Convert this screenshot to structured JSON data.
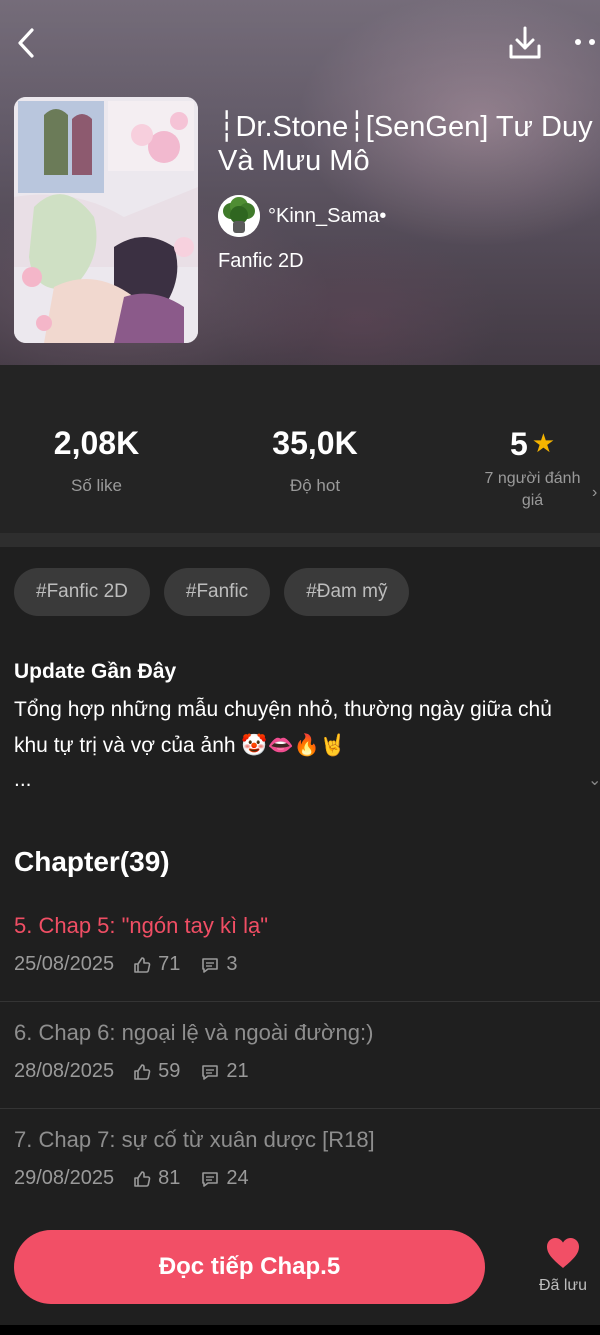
{
  "story": {
    "title": "┆Dr.Stone┆[SenGen] Tư Duy\nVà Mưu Mô",
    "author": "°Kinn_Sama•",
    "genre": "Fanfic 2D"
  },
  "stats": [
    {
      "value": "2,08K",
      "label": "Số like"
    },
    {
      "value": "35,0K",
      "label": "Độ hot"
    },
    {
      "value": "5",
      "label": "7 người đánh\ngiá"
    }
  ],
  "tags": [
    "#Fanfic 2D",
    "#Fanfic",
    "#Đam mỹ"
  ],
  "description": {
    "title": "Update Gần Đây",
    "text": "Tổng hợp những mẫu chuyện nhỏ, thường ngày giữa chủ khu tự trị và vợ của ảnh 🤡👄🔥🤘",
    "more": "..."
  },
  "chapters_header": "Chapter(39)",
  "chapters": [
    {
      "title": "5. Chap 5: \"ngón tay kì lạ\"",
      "date": "25/08/2025",
      "likes": "71",
      "comments": "3",
      "active": true
    },
    {
      "title": "6. Chap 6: ngoại lệ và ngoài đường:)",
      "date": "28/08/2025",
      "likes": "59",
      "comments": "21",
      "active": false
    },
    {
      "title": "7. Chap 7: sự cố từ xuân dược [R18]",
      "date": "29/08/2025",
      "likes": "81",
      "comments": "24",
      "active": false
    }
  ],
  "bottom": {
    "read_label": "Đọc tiếp Chap.5",
    "saved_label": "Đã lưu"
  },
  "colors": {
    "accent": "#f24f66",
    "star": "#f5b400",
    "background": "#1f1f1f"
  },
  "icons": {
    "back": "chevron-left-icon",
    "download": "download-icon",
    "more": "more-dots-icon",
    "like": "thumbs-up-icon",
    "comment": "comment-icon",
    "saved": "heart-icon",
    "star": "star-icon"
  }
}
